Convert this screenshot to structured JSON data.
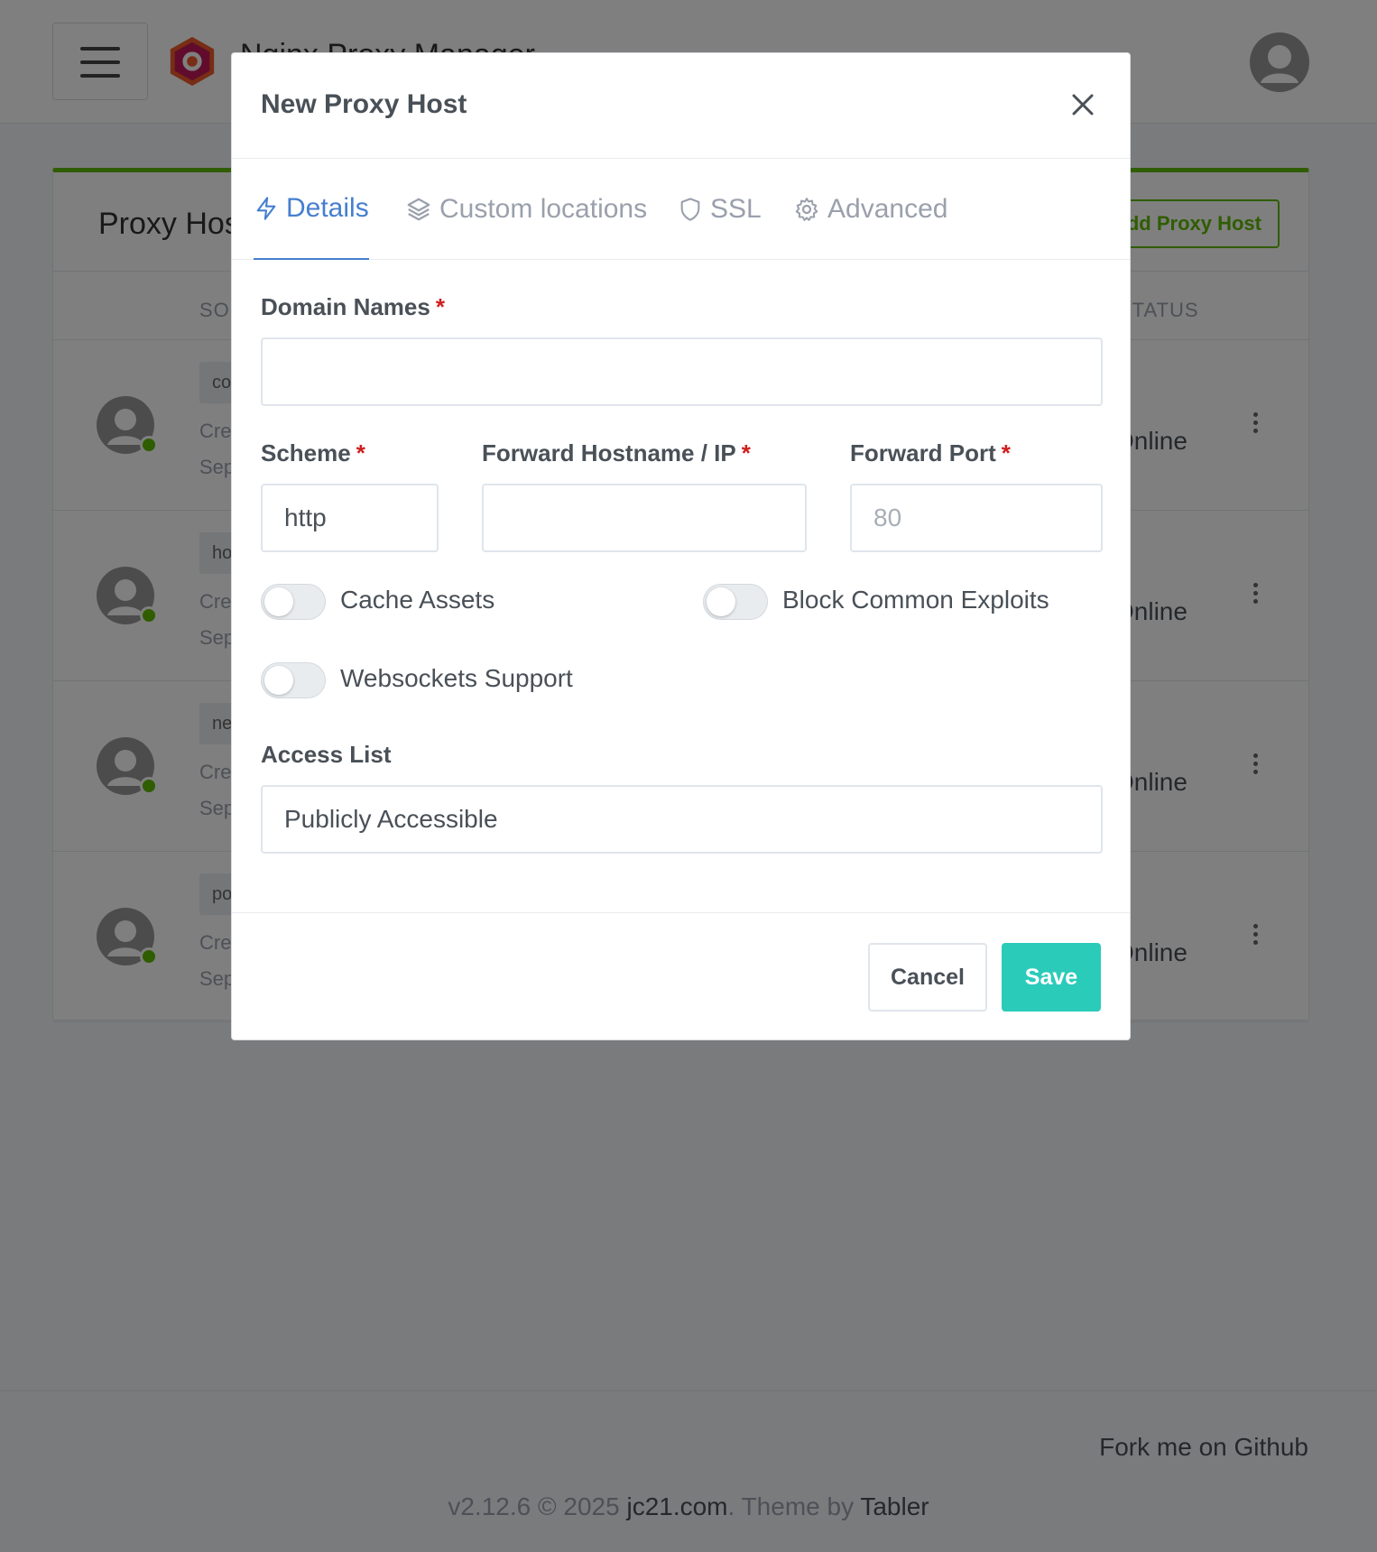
{
  "app": {
    "brand": "Nginx Proxy Manager",
    "page_title": "Proxy Hosts",
    "add_button": "Add Proxy Host",
    "columns": {
      "source": "SOURCE",
      "status": "STATUS"
    },
    "rows": [
      {
        "tag": "co",
        "created": "Created:",
        "date": "Sep",
        "status": "Online"
      },
      {
        "tag": "ho",
        "created": "Created:",
        "date": "Sep",
        "status": "Online"
      },
      {
        "tag": "ne",
        "created": "Created:",
        "date": "Sep",
        "status": "Online"
      },
      {
        "tag": "po",
        "created": "Created:",
        "date": "Sep",
        "status": "Online"
      }
    ],
    "footer": {
      "fork": "Fork me on Github",
      "version": "v2.12.6 © 2025",
      "site": "jc21.com",
      "theme_by": ". Theme by",
      "theme": "Tabler"
    }
  },
  "modal": {
    "title": "New Proxy Host",
    "tabs": [
      {
        "label": "Details",
        "icon": "lightning-icon",
        "active": true
      },
      {
        "label": "Custom locations",
        "icon": "layers-icon",
        "active": false
      },
      {
        "label": "SSL",
        "icon": "shield-icon",
        "active": false
      },
      {
        "label": "Advanced",
        "icon": "gear-icon",
        "active": false
      }
    ],
    "fields": {
      "domain_names": {
        "label": "Domain Names",
        "value": ""
      },
      "scheme": {
        "label": "Scheme",
        "value": "http"
      },
      "forward_hostname": {
        "label": "Forward Hostname / IP",
        "value": ""
      },
      "forward_port": {
        "label": "Forward Port",
        "placeholder": "80",
        "value": ""
      },
      "access_list": {
        "label": "Access List",
        "value": "Publicly Accessible"
      }
    },
    "required_marker": "*",
    "toggles": [
      {
        "label": "Cache Assets",
        "on": false
      },
      {
        "label": "Block Common Exploits",
        "on": false
      },
      {
        "label": "Websockets Support",
        "on": false
      }
    ],
    "buttons": {
      "cancel": "Cancel",
      "save": "Save"
    }
  },
  "colors": {
    "accent": "#467fcf",
    "success": "#5eba00",
    "save": "#2bcbba",
    "required": "#cd201f"
  }
}
